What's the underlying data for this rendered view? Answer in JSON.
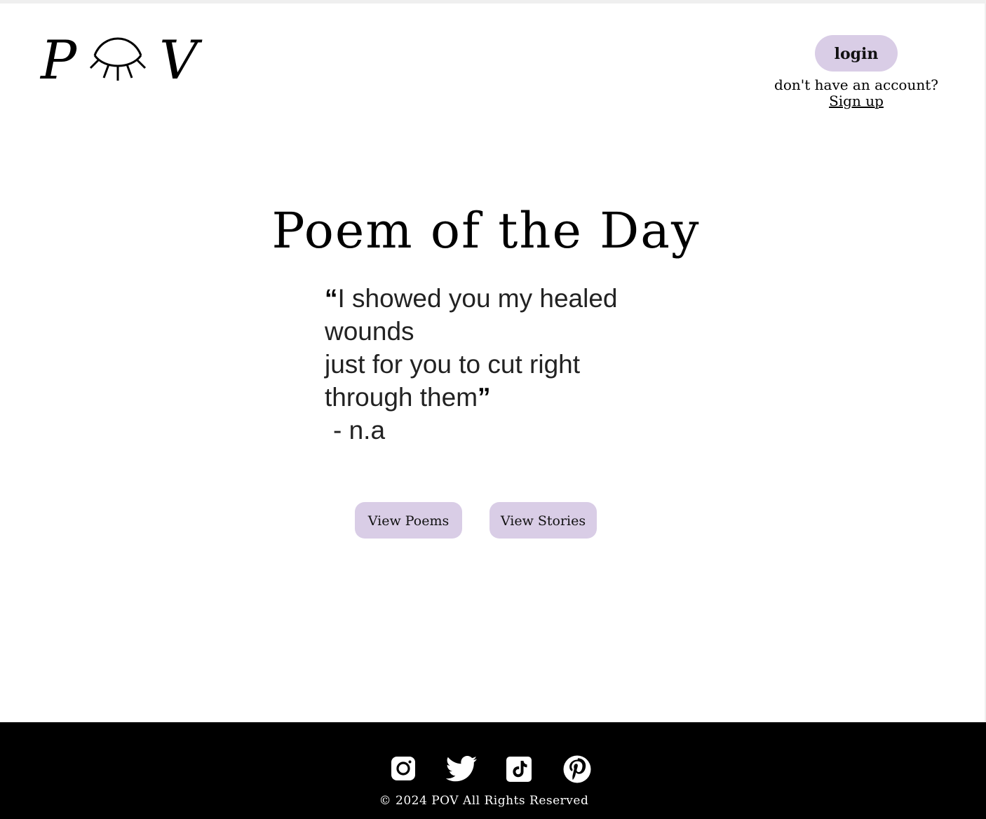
{
  "brand": {
    "logo_letter_left": "P",
    "logo_letter_right": "V",
    "logo_eye_icon": "closed-eye-icon"
  },
  "auth": {
    "login_label": "login",
    "signup_hint": "don't have an account?",
    "signup_link": "Sign up"
  },
  "main": {
    "title": "Poem of the Day",
    "quote": {
      "open_mark": "“",
      "line1": "I showed you my healed",
      "line2": "wounds",
      "line3": "just for you to cut right",
      "line4": "through them",
      "close_mark": "”",
      "author": "- n.a"
    },
    "buttons": {
      "view_poems": "View Poems",
      "view_stories": "View Stories"
    }
  },
  "footer": {
    "social": [
      "instagram-icon",
      "twitter-icon",
      "tiktok-icon",
      "pinterest-icon"
    ],
    "copyright": "© 2024 POV All Rights Reserved"
  },
  "colors": {
    "accent": "#d9cde6",
    "footer_bg": "#000000",
    "text": "#000000"
  }
}
